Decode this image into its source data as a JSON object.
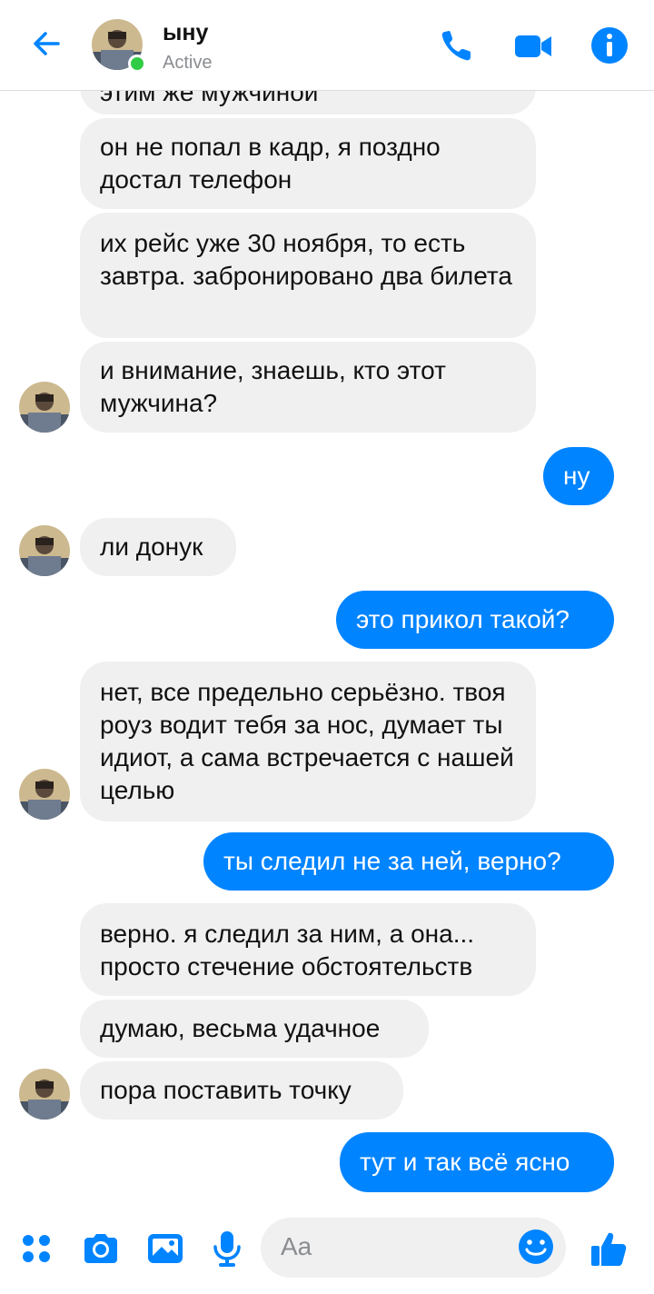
{
  "header": {
    "contact_name": "ыну",
    "status": "Active",
    "icons": {
      "back": "arrow-left-icon",
      "call": "phone-icon",
      "video": "video-camera-icon",
      "info": "info-icon"
    }
  },
  "colors": {
    "accent": "#0084ff",
    "incoming_bubble": "#f0f0f0",
    "online": "#31cc46"
  },
  "messages": [
    {
      "from": "contact",
      "text": "этим же мужчиной"
    },
    {
      "from": "contact",
      "text": "он не попал в кадр, я поздно достал телефон"
    },
    {
      "from": "contact",
      "text": "их рейс уже 30 ноября, то есть завтра. забронировано два билета"
    },
    {
      "from": "contact",
      "text": "и внимание, знаешь, кто этот мужчина?"
    },
    {
      "from": "me",
      "text": "ну"
    },
    {
      "from": "contact",
      "text": "ли донук"
    },
    {
      "from": "me",
      "text": "это прикол такой?"
    },
    {
      "from": "contact",
      "text": "нет, все предельно серьёзно. твоя роуз водит тебя за нос, думает ты идиот, а сама встречается с нашей целью"
    },
    {
      "from": "me",
      "text": "ты следил не за ней, верно?"
    },
    {
      "from": "contact",
      "text": "верно. я следил за ним, а она... просто стечение обстоятельств"
    },
    {
      "from": "contact",
      "text": "думаю, весьма удачное"
    },
    {
      "from": "contact",
      "text": "пора поставить точку"
    },
    {
      "from": "me",
      "text": "тут и так всё ясно"
    }
  ],
  "composer": {
    "placeholder": "Aa",
    "icons": {
      "menu": "four-dots-icon",
      "camera": "camera-icon",
      "gallery": "image-icon",
      "mic": "microphone-icon",
      "emoji": "smiley-icon",
      "like": "thumbs-up-icon"
    }
  }
}
